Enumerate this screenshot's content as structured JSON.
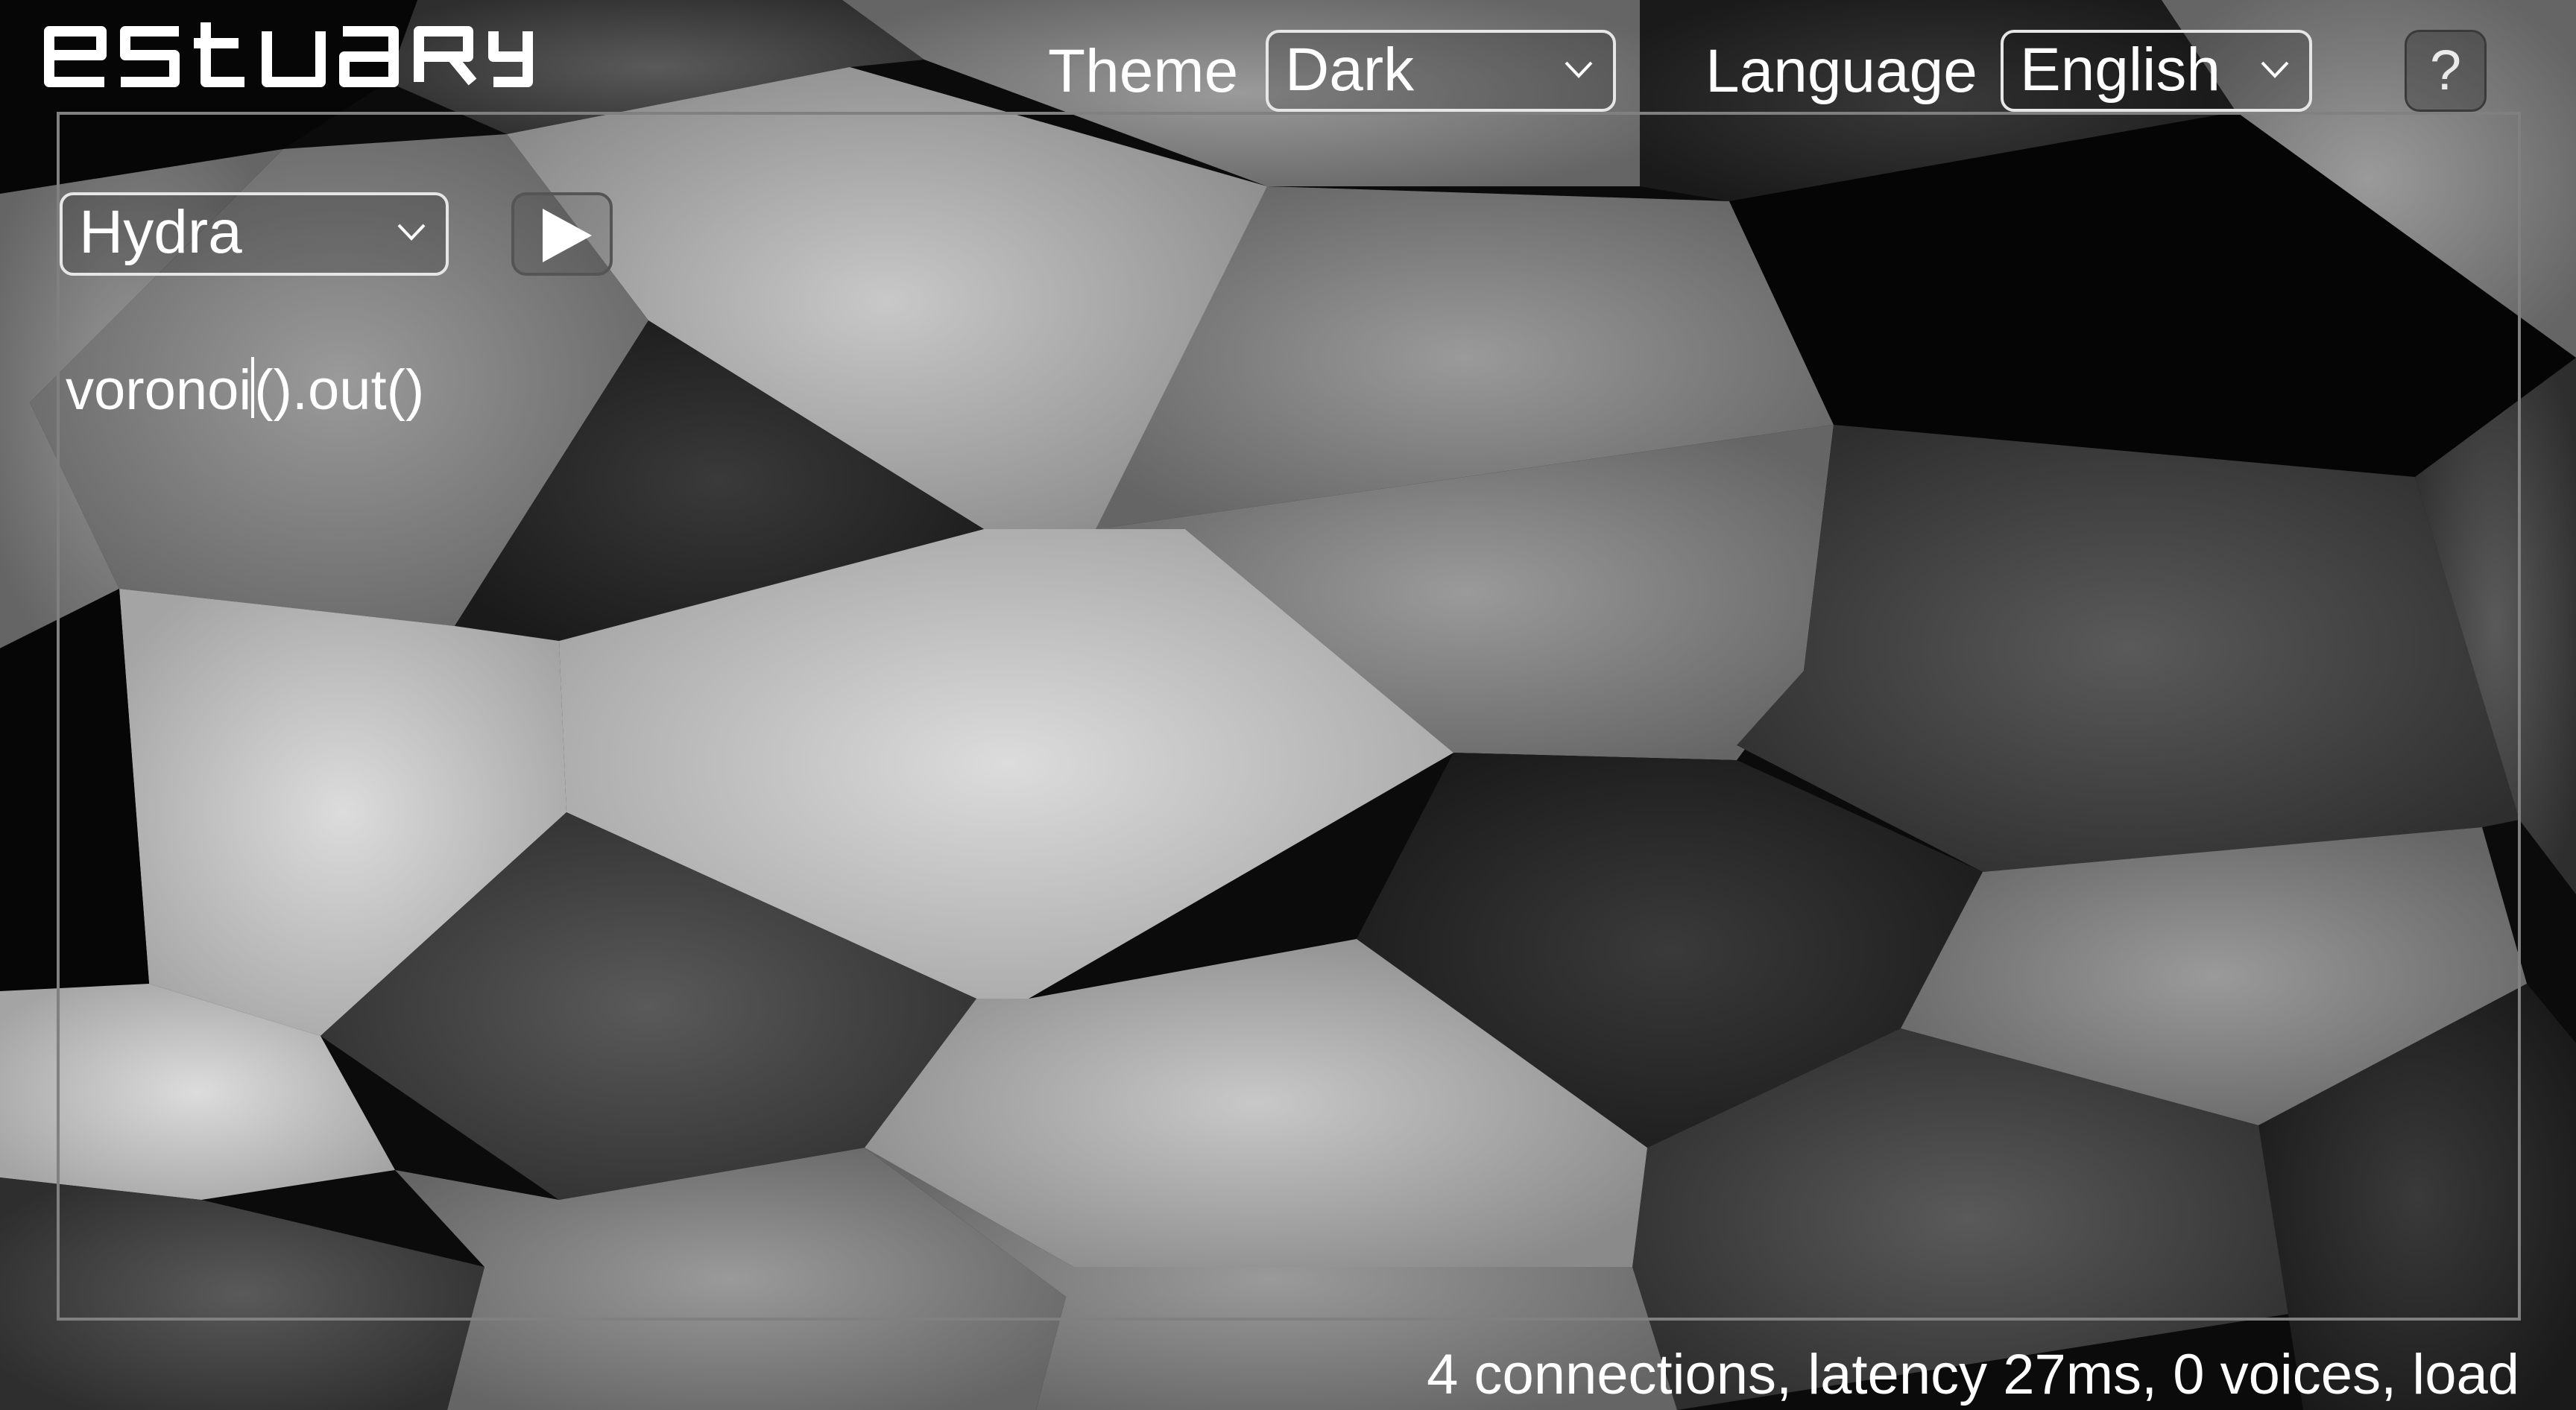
{
  "app": {
    "logo_text": "estuary"
  },
  "header": {
    "theme_label": "Theme",
    "theme_value": "Dark",
    "language_label": "Language",
    "language_value": "English",
    "help_label": "?"
  },
  "ensemble": {
    "language_select": "Hydra",
    "play_icon": "play-icon",
    "code": {
      "before_caret": "voronoi",
      "after_caret": "().out()"
    }
  },
  "status": {
    "text": "4 connections, latency 27ms, 0 voices, load"
  },
  "colors": {
    "text": "#ffffff",
    "frame": "#808080",
    "background": "#000000"
  },
  "icons": [
    "chevron-down-icon",
    "play-icon",
    "help-icon"
  ]
}
